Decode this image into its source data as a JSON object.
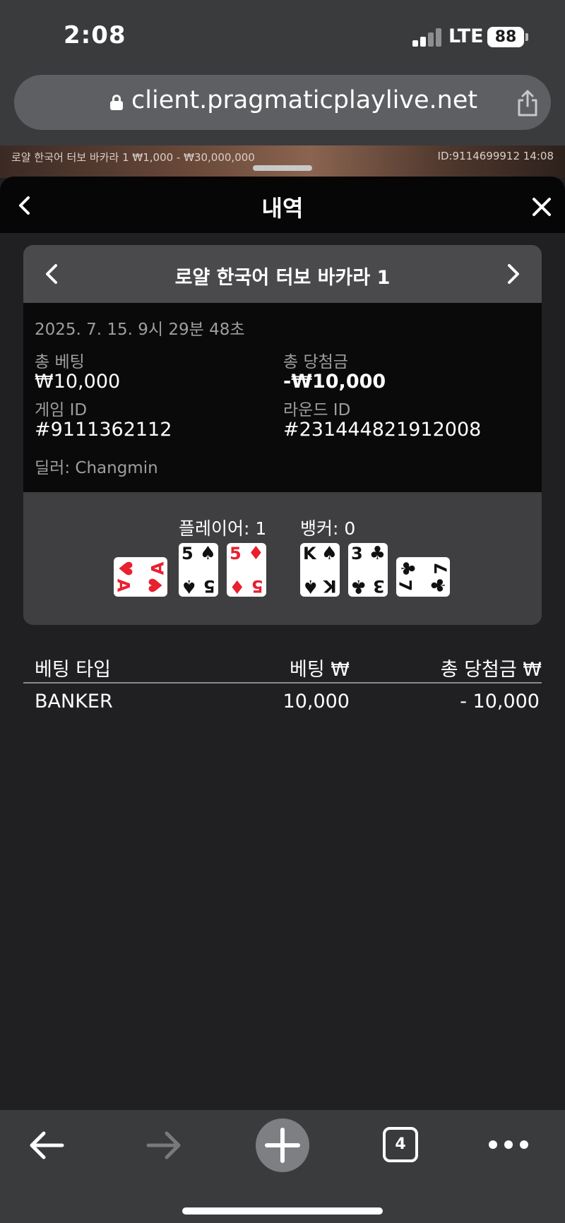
{
  "status": {
    "time": "2:08",
    "network": "LTE",
    "battery": "88"
  },
  "browser": {
    "url": "client.pragmaticplaylive.net"
  },
  "background": {
    "left_text": "로얄 한국어 터보 바카라 1  ₩1,000 - ₩30,000,000",
    "right_text": "ID:9114699912  14:08"
  },
  "sheet": {
    "title": "내역",
    "game_title": "로얄 한국어 터보 바카라 1",
    "date": "2025. 7. 15. 9시 29분 48초",
    "total_bet_label": "총 베팅",
    "total_bet_value": "₩10,000",
    "total_win_label": "총 당첨금",
    "total_win_value": "-₩10,000",
    "game_id_label": "게임 ID",
    "game_id_value": "#9111362112",
    "round_id_label": "라운드 ID",
    "round_id_value": "#231444821912008",
    "dealer": "딜러: Changmin",
    "player_label": "플레이어: 1",
    "banker_label": "뱅커: 0",
    "player_cards": [
      {
        "rank": "A",
        "suit": "♥",
        "color": "red",
        "rotated": true
      },
      {
        "rank": "5",
        "suit": "♠",
        "color": "black",
        "rotated": false
      },
      {
        "rank": "5",
        "suit": "♦",
        "color": "red",
        "rotated": false
      }
    ],
    "banker_cards": [
      {
        "rank": "K",
        "suit": "♠",
        "color": "black",
        "rotated": false
      },
      {
        "rank": "3",
        "suit": "♣",
        "color": "black",
        "rotated": false
      },
      {
        "rank": "7",
        "suit": "♣",
        "color": "black",
        "rotated": true
      }
    ],
    "table": {
      "headers": [
        "베팅 타입",
        "베팅 ₩",
        "총 당첨금 ₩"
      ],
      "rows": [
        [
          "BANKER",
          "10,000",
          "- 10,000"
        ]
      ]
    }
  },
  "toolbar": {
    "tabs_count": "4"
  }
}
